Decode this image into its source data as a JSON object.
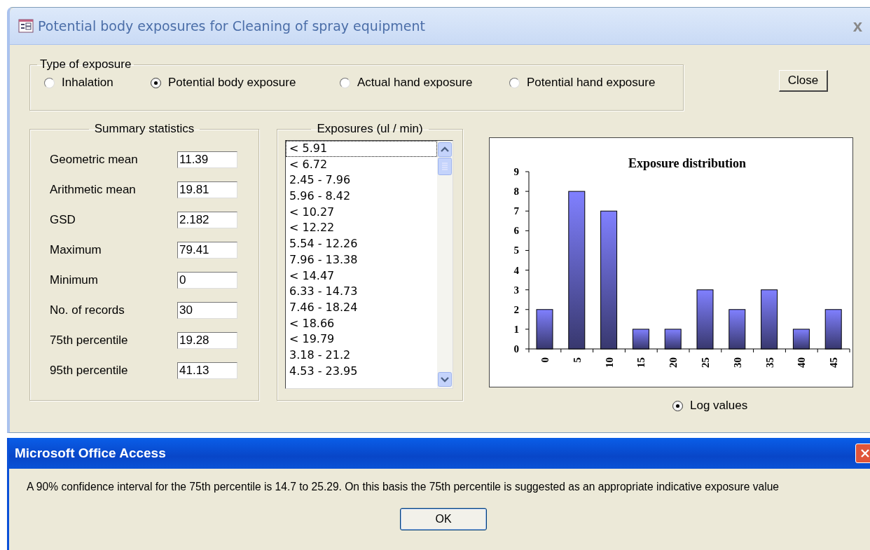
{
  "window": {
    "title": "Potential body exposures for Cleaning of spray equipment",
    "close": "x"
  },
  "exposure_type": {
    "label": "Type of exposure",
    "options": [
      {
        "label": "Inhalation",
        "selected": false
      },
      {
        "label": "Potential body exposure",
        "selected": true
      },
      {
        "label": "Actual hand exposure",
        "selected": false
      },
      {
        "label": "Potential hand exposure",
        "selected": false
      }
    ]
  },
  "close_button": "Close",
  "summary": {
    "label": "Summary statistics",
    "rows": [
      {
        "label": "Geometric mean",
        "value": "11.39"
      },
      {
        "label": "Arithmetic mean",
        "value": "19.81"
      },
      {
        "label": "GSD",
        "value": "2.182"
      },
      {
        "label": "Maximum",
        "value": "79.41"
      },
      {
        "label": "Minimum",
        "value": "0"
      },
      {
        "label": "No. of records",
        "value": "30"
      },
      {
        "label": "75th percentile",
        "value": "19.28"
      },
      {
        "label": "95th percentile",
        "value": "41.13"
      }
    ]
  },
  "exposures": {
    "label": "Exposures (ul / min)",
    "items": [
      {
        "text": "< 5.91",
        "selected": true
      },
      {
        "text": "< 6.72",
        "selected": false
      },
      {
        "text": "2.45 - 7.96",
        "selected": false
      },
      {
        "text": "5.96 - 8.42",
        "selected": false
      },
      {
        "text": "< 10.27",
        "selected": false
      },
      {
        "text": "< 12.22",
        "selected": false
      },
      {
        "text": "5.54 - 12.26",
        "selected": false
      },
      {
        "text": "7.96 - 13.38",
        "selected": false
      },
      {
        "text": "< 14.47",
        "selected": false
      },
      {
        "text": "6.33 - 14.73",
        "selected": false
      },
      {
        "text": "7.46 - 18.24",
        "selected": false
      },
      {
        "text": "< 18.66",
        "selected": false
      },
      {
        "text": "< 19.79",
        "selected": false
      },
      {
        "text": "3.18 - 21.2",
        "selected": false
      },
      {
        "text": "4.53 - 23.95",
        "selected": false
      }
    ]
  },
  "chart": {
    "chart_data": {
      "type": "bar",
      "title": "Exposure distribution",
      "categories": [
        "0",
        "5",
        "10",
        "15",
        "20",
        "25",
        "30",
        "35",
        "40",
        "45"
      ],
      "values": [
        2,
        8,
        7,
        1,
        1,
        3,
        2,
        3,
        1,
        2
      ],
      "ylim": [
        0,
        9
      ],
      "yticks": [
        0,
        1,
        2,
        3,
        4,
        5,
        6,
        7,
        8,
        9
      ]
    }
  },
  "log_values": {
    "label": "Log values",
    "selected": true
  },
  "dialog": {
    "title": "Microsoft Office Access",
    "message": "A 90% confidence interval for the 75th percentile is 14.7 to 25.29. On this basis the 75th percentile is suggested as an appropriate indicative exposure value",
    "ok": "OK"
  }
}
